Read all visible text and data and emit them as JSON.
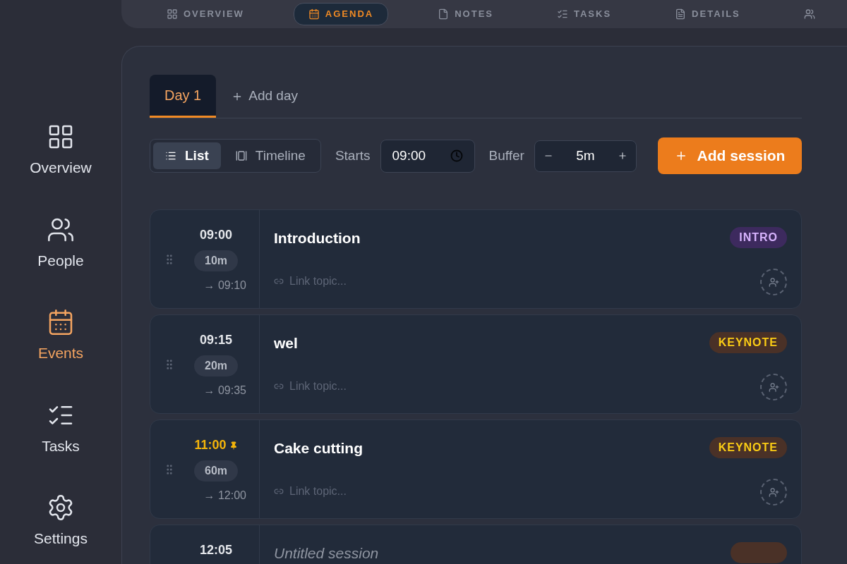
{
  "sidebar": {
    "items": [
      {
        "label": "Overview",
        "selected": false
      },
      {
        "label": "People",
        "selected": false
      },
      {
        "label": "Events",
        "selected": true
      },
      {
        "label": "Tasks",
        "selected": false
      },
      {
        "label": "Settings",
        "selected": false
      }
    ]
  },
  "top_tabs": [
    {
      "label": "OVERVIEW",
      "selected": false
    },
    {
      "label": "AGENDA",
      "selected": true
    },
    {
      "label": "NOTES",
      "selected": false
    },
    {
      "label": "TASKS",
      "selected": false
    },
    {
      "label": "DETAILS",
      "selected": false
    },
    {
      "selected": false
    }
  ],
  "days": {
    "tabs": [
      {
        "label": "Day 1",
        "selected": true
      }
    ],
    "add_label": "Add day"
  },
  "toolbar": {
    "views": [
      {
        "label": "List",
        "selected": true
      },
      {
        "label": "Timeline",
        "selected": false
      }
    ],
    "starts_label": "Starts",
    "starts_value": "09:00",
    "buffer_label": "Buffer",
    "buffer_value": "5m",
    "add_button": "Add session"
  },
  "sessions": [
    {
      "start": "09:00",
      "pinned": false,
      "duration": "10m",
      "end": "→ 09:10",
      "title": "Introduction",
      "untitled": false,
      "tag": "INTRO",
      "kind": "intro",
      "topic_placeholder": "Link topic..."
    },
    {
      "start": "09:15",
      "pinned": false,
      "duration": "20m",
      "end": "→ 09:35",
      "title": "wel",
      "untitled": false,
      "tag": "KEYNOTE",
      "kind": "keynote",
      "topic_placeholder": "Link topic..."
    },
    {
      "start": "11:00",
      "pinned": true,
      "duration": "60m",
      "end": "→ 12:00",
      "title": "Cake cutting",
      "untitled": false,
      "tag": "KEYNOTE",
      "kind": "keynote",
      "topic_placeholder": "Link topic..."
    },
    {
      "start": "12:05",
      "pinned": false,
      "title": "Untitled session",
      "untitled": true,
      "kind": "keynote"
    }
  ]
}
